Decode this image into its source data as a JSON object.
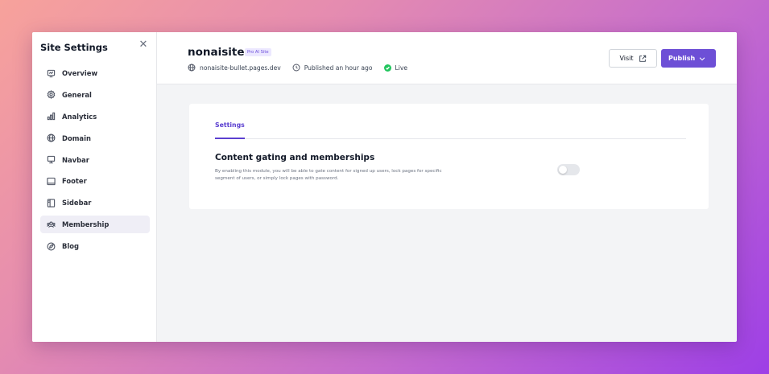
{
  "sidebar": {
    "title": "Site Settings",
    "items": [
      {
        "label": "Overview",
        "icon": "overview-icon"
      },
      {
        "label": "General",
        "icon": "gear-icon"
      },
      {
        "label": "Analytics",
        "icon": "analytics-icon"
      },
      {
        "label": "Domain",
        "icon": "globe-icon"
      },
      {
        "label": "Navbar",
        "icon": "navbar-icon"
      },
      {
        "label": "Footer",
        "icon": "footer-icon"
      },
      {
        "label": "Sidebar",
        "icon": "sidebar-icon"
      },
      {
        "label": "Membership",
        "icon": "membership-icon",
        "active": true
      },
      {
        "label": "Blog",
        "icon": "blog-icon"
      }
    ]
  },
  "header": {
    "site_name": "nonaisite",
    "plan_badge": "Pro AI Site",
    "domain": "nonaisite-bullet.pages.dev",
    "published": "Published an hour ago",
    "status": "Live",
    "visit_label": "Visit",
    "publish_label": "Publish"
  },
  "content": {
    "tab_label": "Settings",
    "section_title": "Content gating and memberships",
    "section_desc": "By enabling this module, you will be able to gate content for signed up users, lock pages for specific segment of users, or simply lock pages with password.",
    "toggle_on": false
  },
  "colors": {
    "accent": "#6d4fd6",
    "live": "#22c55e"
  }
}
